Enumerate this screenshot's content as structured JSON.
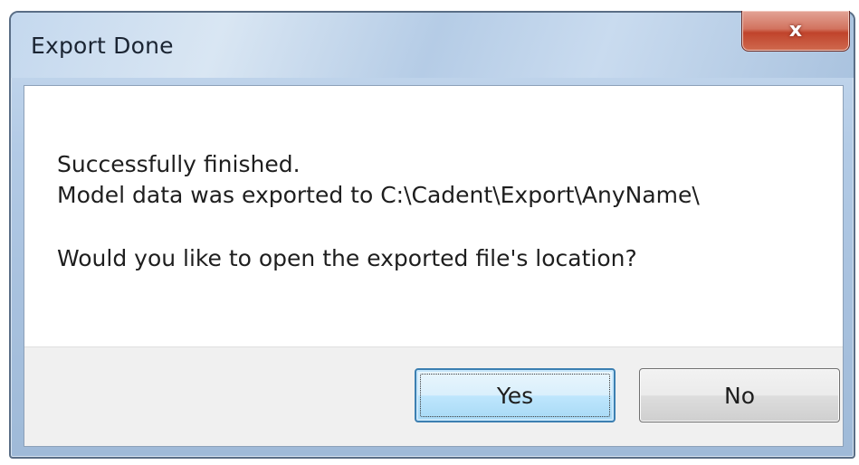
{
  "window": {
    "title": "Export Done",
    "close_glyph": "x"
  },
  "message": {
    "line1": "Successfully finished.",
    "line2": "Model data was exported to C:\\Cadent\\Export\\AnyName\\",
    "line3": "Would you like to open the exported file's location?"
  },
  "buttons": {
    "yes_label": "Yes",
    "no_label": "No"
  },
  "colors": {
    "close_button": "#c0432b",
    "default_button_border": "#3c7fb1"
  }
}
